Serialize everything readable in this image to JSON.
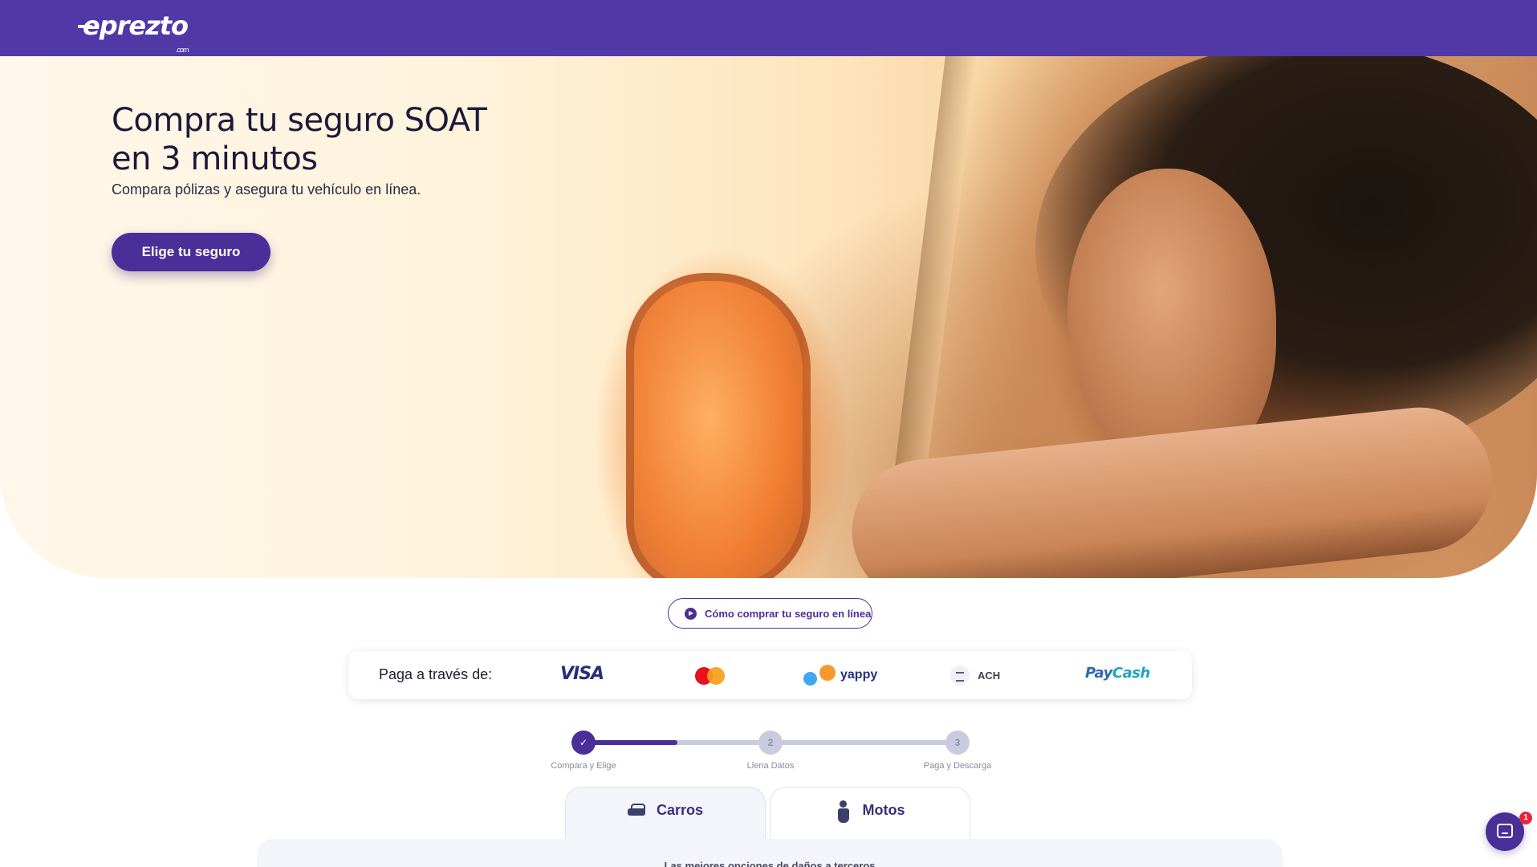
{
  "brand": {
    "logo_text": "eprezto",
    "logo_suffix": ".com",
    "primary_color": "#5038a6",
    "accent_color": "#4a2f99"
  },
  "hero": {
    "title": "Compra tu seguro SOAT en 3 minutos",
    "subtitle": "Compara pólizas y asegura tu vehículo en línea.",
    "cta_label": "Elige tu seguro"
  },
  "howto_button": {
    "label": "Cómo comprar tu seguro en línea",
    "icon": "play-circle-icon"
  },
  "payments": {
    "label": "Paga a través de:",
    "methods": [
      {
        "name": "VISA",
        "icon": "visa-logo"
      },
      {
        "name": "Mastercard",
        "icon": "mastercard-logo"
      },
      {
        "name": "yappy",
        "icon": "yappy-logo"
      },
      {
        "name": "ACH",
        "icon": "bank-icon"
      },
      {
        "name": "PayCash",
        "icon": "paycash-logo"
      }
    ],
    "paycash_part1": "Pay",
    "paycash_part2": "Cash"
  },
  "steps": {
    "items": [
      {
        "number": "1",
        "label": "Compara y Elige",
        "status": "done"
      },
      {
        "number": "2",
        "label": "Llena Datos",
        "status": "pending"
      },
      {
        "number": "3",
        "label": "Paga y Descarga",
        "status": "pending"
      }
    ],
    "progress": 0.25
  },
  "vehicle_tabs": [
    {
      "label": "Carros",
      "icon": "car-icon",
      "active": true
    },
    {
      "label": "Motos",
      "icon": "scooter-icon",
      "active": false
    }
  ],
  "panel": {
    "heading": "Las mejores opciones de daños a terceros"
  },
  "chat": {
    "icon": "chat-icon",
    "badge_count": "1"
  }
}
